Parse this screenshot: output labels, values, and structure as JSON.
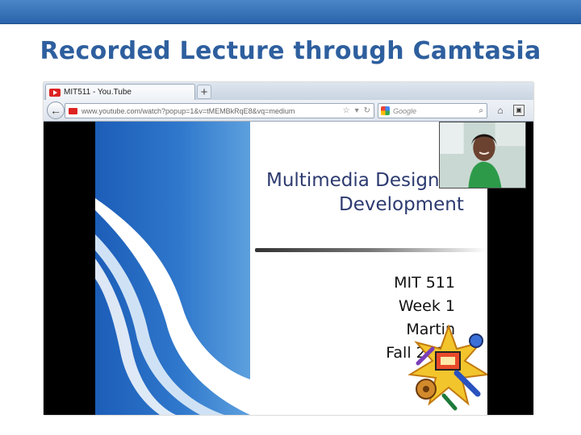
{
  "slide": {
    "title": "Recorded Lecture through Camtasia"
  },
  "browser": {
    "tab_label": "MIT511 - You.Tube",
    "new_tab_symbol": "+",
    "url": "www.youtube.com/watch?popup=1&v=tMEMBkRqE8&vq=medium",
    "search_placeholder": "Google",
    "back_icon": "back-arrow-icon",
    "home_icon": "home-icon"
  },
  "lecture_slide": {
    "heading_line1": "Multimedia Design",
    "heading_line2": "Development",
    "course": "MIT 511",
    "week": "Week 1",
    "instructor": "Martin",
    "term": "Fall 2012"
  },
  "colors": {
    "title_blue": "#2e5f9e",
    "band_blue": "#3a74ba",
    "slide_blue": "#2f78cc",
    "heading_navy": "#2d3b70"
  }
}
